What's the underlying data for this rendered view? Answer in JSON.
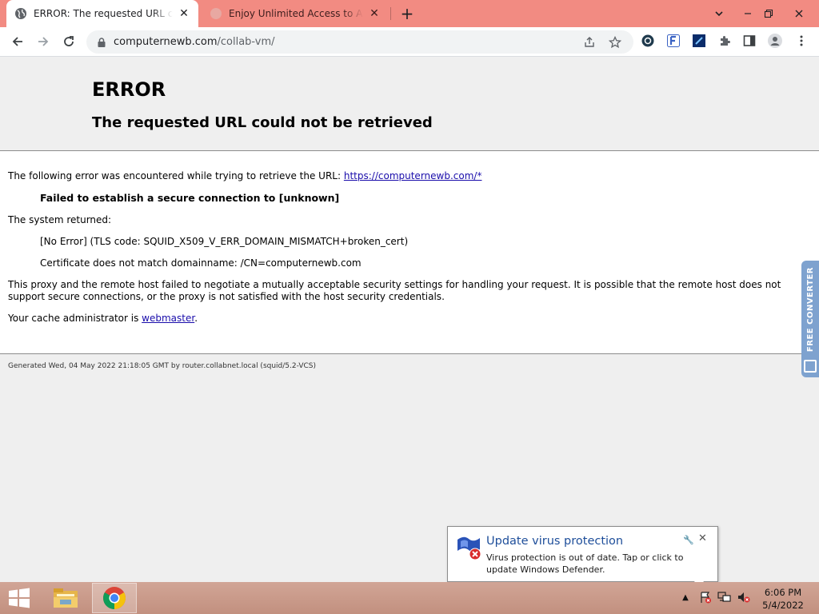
{
  "browser": {
    "tabs": [
      {
        "title": "ERROR: The requested URL could not be retrieved",
        "active": true
      },
      {
        "title": "Enjoy Unlimited Access to All our",
        "active": false
      }
    ],
    "url_domain": "computernewb.com",
    "url_path": "/collab-vm/"
  },
  "page": {
    "heading": "ERROR",
    "subheading": "The requested URL could not be retrieved",
    "intro_text": "The following error was encountered while trying to retrieve the URL:",
    "intro_link": "https://computernewb.com/*",
    "error_title": "Failed to establish a secure connection to [unknown]",
    "system_returned_label": "The system returned:",
    "system_error": "[No Error] (TLS code: SQUID_X509_V_ERR_DOMAIN_MISMATCH+broken_cert)",
    "cert_detail": "Certificate does not match domainname: /CN=computernewb.com",
    "explanation": "This proxy and the remote host failed to negotiate a mutually acceptable security settings for handling your request. It is possible that the remote host does not support secure connections, or the proxy is not satisfied with the host security credentials.",
    "admin_text": "Your cache administrator is",
    "admin_link": "webmaster",
    "admin_suffix": ".",
    "footer": "Generated Wed, 04 May 2022 21:18:05 GMT by router.collabnet.local (squid/5.2-VCS)"
  },
  "side_tab": {
    "label": "FREE CONVERTER"
  },
  "notification": {
    "title": "Update virus protection",
    "body": "Virus protection is out of date. Tap or click to update Windows Defender."
  },
  "taskbar": {
    "time": "6:06 PM",
    "date": "5/4/2022"
  },
  "colors": {
    "tabstrip": "#f28b82",
    "link": "#1a0dab",
    "notification_title": "#1e4e9a",
    "taskbar": "#c89a8a"
  }
}
